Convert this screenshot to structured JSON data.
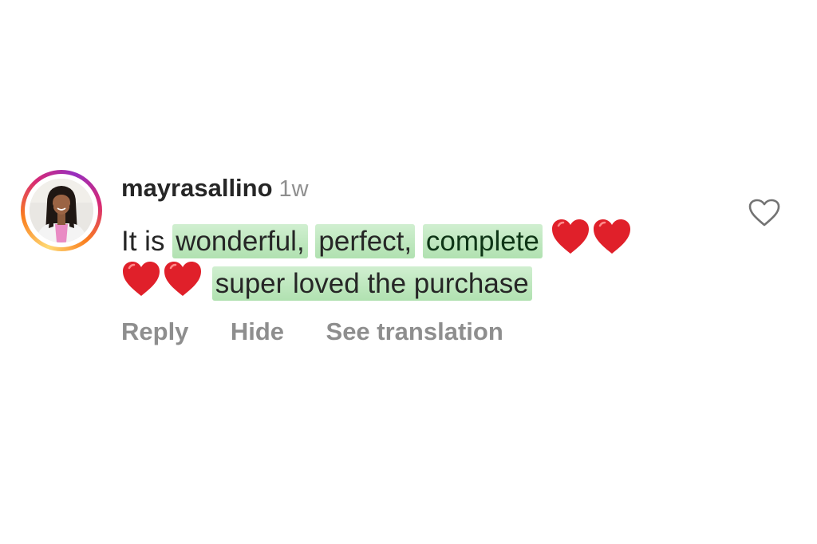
{
  "comment": {
    "username": "mayrasallino",
    "time": "1w",
    "line1": {
      "plain": "It is ",
      "highlight_1": "wonderful,",
      "highlight_2": "perfect,",
      "highlight_3": "complete"
    },
    "line2": {
      "highlight_4": "super loved the purchase"
    },
    "emoji_before_line2": "heart",
    "emoji_after_line1": "heart",
    "highlight_color": "#a6dea6",
    "heart_color": "#e0202a",
    "ring_colors": [
      "#feda75",
      "#fa7e1e",
      "#d62976",
      "#962fbf"
    ]
  },
  "actions": {
    "reply_label": "Reply",
    "hide_label": "Hide",
    "translate_label": "See translation"
  },
  "icons": {
    "like": "heart-outline-icon",
    "emoji": "red-heart-emoji"
  }
}
